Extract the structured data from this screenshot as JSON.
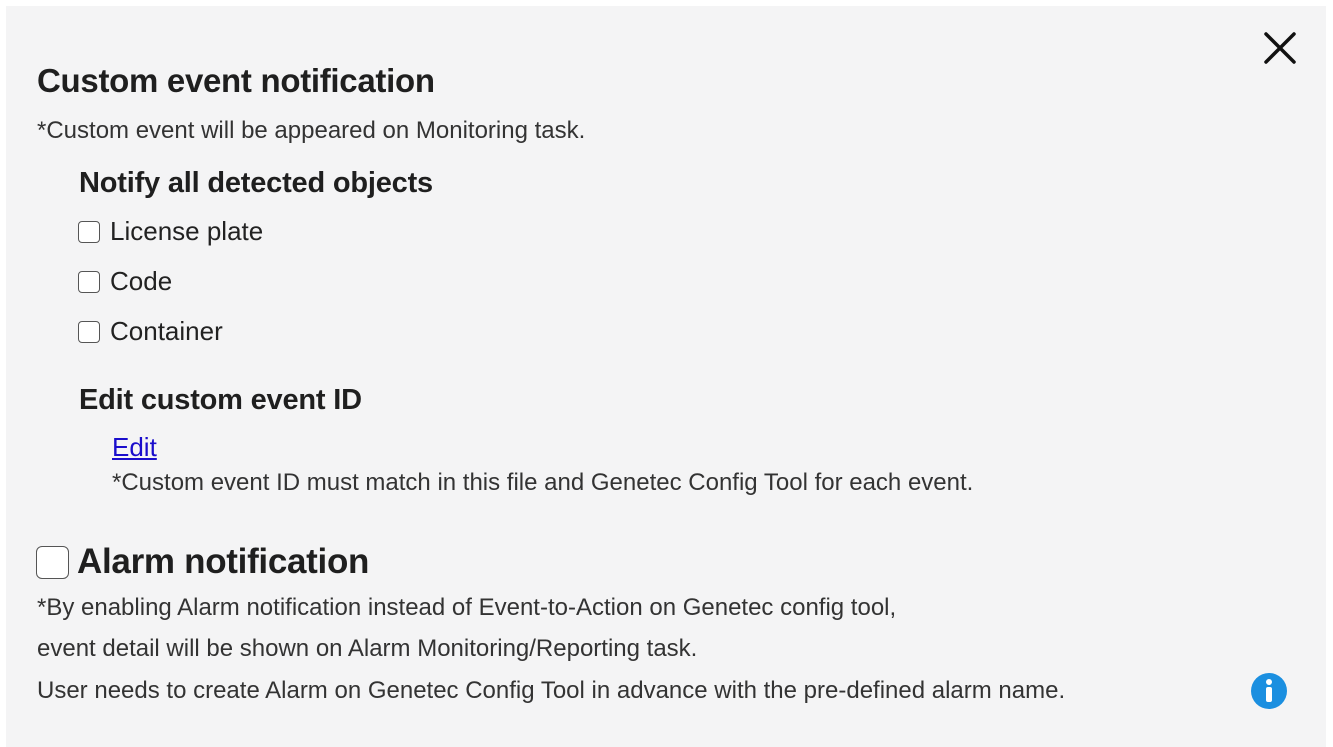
{
  "dialog": {
    "title": "Custom event notification",
    "subtitle_note": "*Custom event will be appeared on Monitoring task.",
    "close_icon": "close-icon"
  },
  "notify": {
    "heading": "Notify all detected objects",
    "options": [
      {
        "label": "License plate",
        "checked": false
      },
      {
        "label": "Code",
        "checked": false
      },
      {
        "label": "Container",
        "checked": false
      }
    ]
  },
  "edit_id": {
    "heading": "Edit custom event ID",
    "link_label": "Edit",
    "note": "*Custom event ID must match in this file and Genetec Config Tool for each event."
  },
  "alarm": {
    "label": "Alarm notification",
    "checked": false,
    "notes": [
      "*By enabling Alarm notification instead of Event-to-Action on Genetec config tool,",
      "event detail will be shown on Alarm Monitoring/Reporting task.",
      "User needs to create Alarm on Genetec Config Tool in advance with the pre-defined alarm name."
    ],
    "info_icon": "info-icon"
  },
  "colors": {
    "panel_bg": "#f4f4f5",
    "link": "#1a0dcc",
    "info_blue": "#1b8fe0"
  }
}
